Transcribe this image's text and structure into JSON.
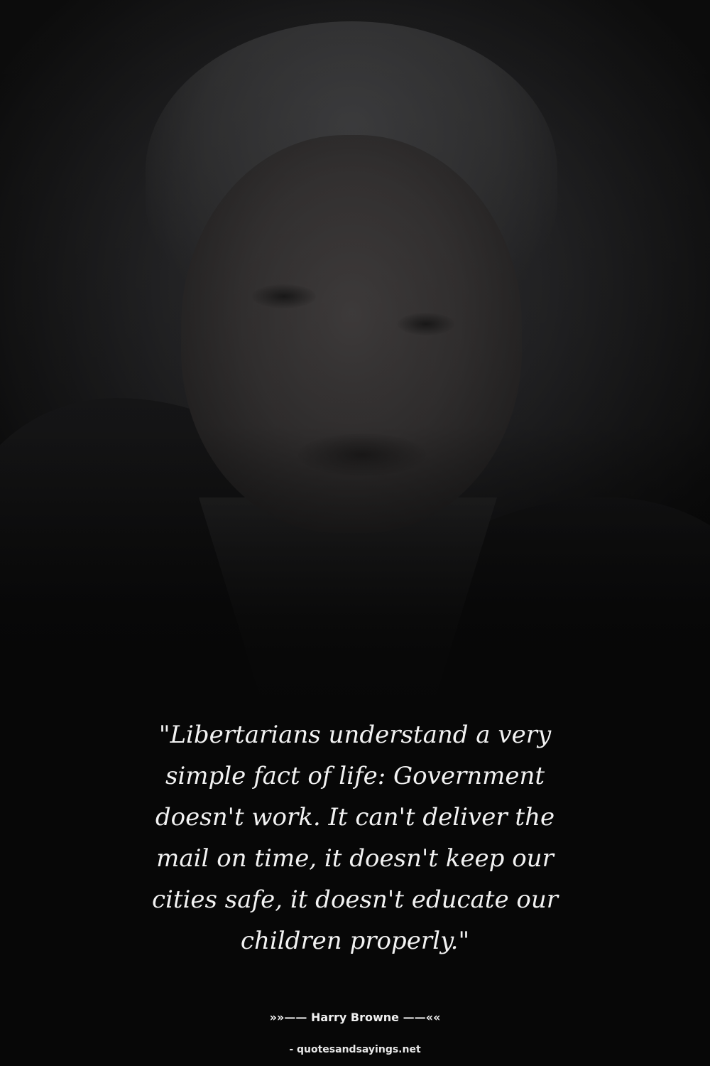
{
  "background": {
    "subject": "portrait-photo",
    "colors": {
      "page": "#070707",
      "quote_text": "#f2f2f2"
    }
  },
  "quote": {
    "text": "\"Libertarians understand a very\nsimple fact of life: Government\ndoesn't work. It can't deliver the\nmail on time, it doesn't keep our\ncities safe, it doesn't educate our\nchildren properly.\""
  },
  "attribution": {
    "author_line": "»»—— Harry Browne ——««"
  },
  "source": {
    "text": "- quotesandsayings.net"
  }
}
